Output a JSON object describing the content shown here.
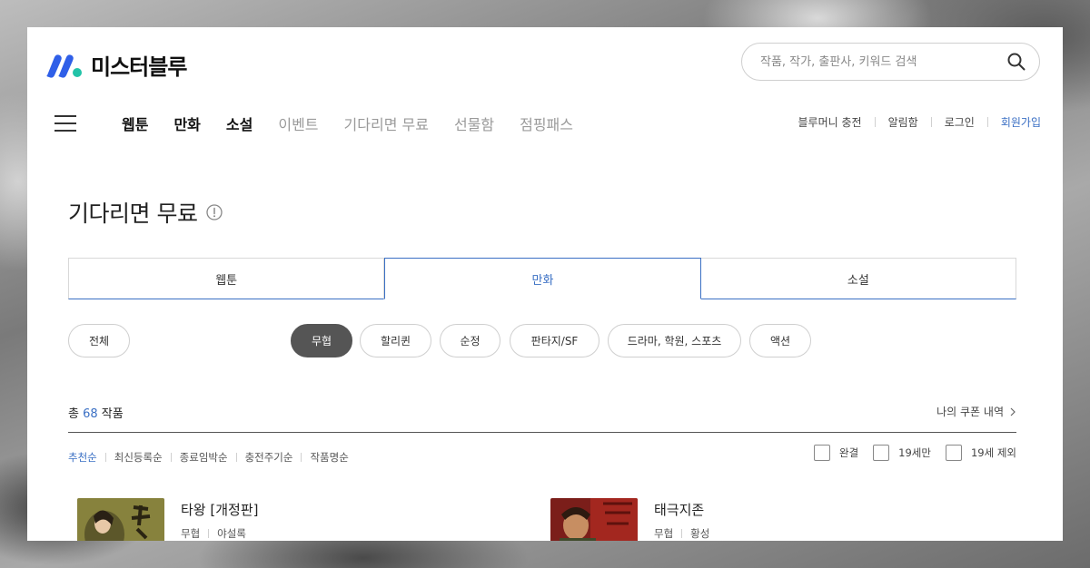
{
  "header": {
    "logo_text": "미스터블루",
    "search_placeholder": "작품, 작가, 출판사, 키워드 검색"
  },
  "nav": {
    "links": [
      {
        "label": "웹툰",
        "style": "bold"
      },
      {
        "label": "만화",
        "style": "bold"
      },
      {
        "label": "소설",
        "style": "bold"
      },
      {
        "label": "이벤트",
        "style": "muted"
      },
      {
        "label": "기다리면 무료",
        "style": "muted"
      },
      {
        "label": "선물함",
        "style": "muted"
      },
      {
        "label": "점핑패스",
        "style": "muted"
      }
    ],
    "util": {
      "recharge": "블루머니 충전",
      "notifications": "알림함",
      "login": "로그인",
      "signup": "회원가입"
    }
  },
  "page": {
    "title": "기다리면 무료"
  },
  "tabs": [
    {
      "label": "웹툰",
      "active": false
    },
    {
      "label": "만화",
      "active": true
    },
    {
      "label": "소설",
      "active": false
    }
  ],
  "chips": [
    {
      "label": "전체",
      "active": false
    },
    {
      "label": "무협",
      "active": true
    },
    {
      "label": "할리퀸",
      "active": false
    },
    {
      "label": "순정",
      "active": false
    },
    {
      "label": "판타지/SF",
      "active": false
    },
    {
      "label": "드라마, 학원, 스포츠",
      "active": false
    },
    {
      "label": "액션",
      "active": false
    }
  ],
  "summary": {
    "prefix": "총",
    "count": "68",
    "suffix": "작품",
    "coupon_link": "나의 쿠폰 내역"
  },
  "sort": {
    "options": [
      "추천순",
      "최신등록순",
      "종료임박순",
      "충전주기순",
      "작품명순"
    ],
    "active": "추천순"
  },
  "filters": {
    "completed": "완결",
    "adult_only": "19세만",
    "exclude_adult": "19세 제외"
  },
  "works": [
    {
      "title": "타왕 [개정판]",
      "genre": "무협",
      "author": "야설록"
    },
    {
      "title": "태극지존",
      "genre": "무협",
      "author": "황성"
    }
  ],
  "colors": {
    "accent": "#3a6fc4",
    "active_chip": "#555555",
    "logo_blue": "#2f5fe8",
    "logo_teal": "#22c3a8"
  }
}
